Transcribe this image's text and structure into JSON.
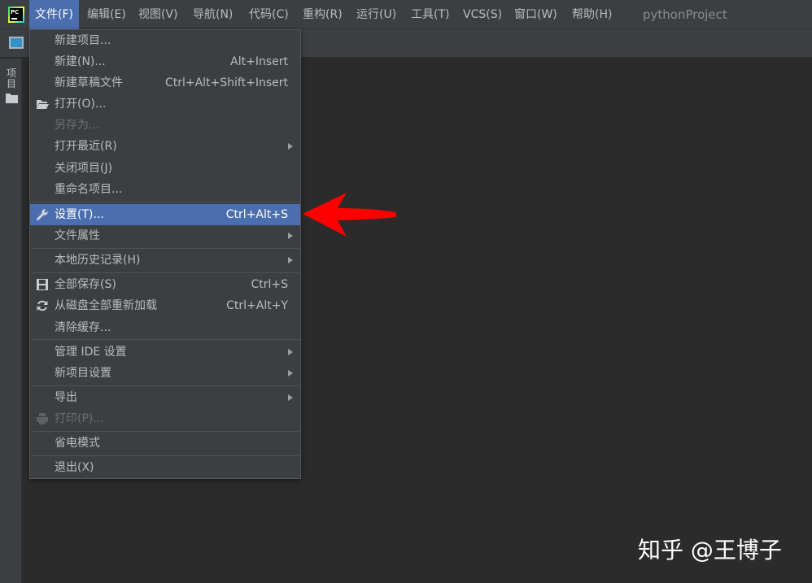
{
  "menubar": {
    "items": [
      {
        "label": "文件(F)"
      },
      {
        "label": "编辑(E)"
      },
      {
        "label": "视图(V)"
      },
      {
        "label": "导航(N)"
      },
      {
        "label": "代码(C)"
      },
      {
        "label": "重构(R)"
      },
      {
        "label": "运行(U)"
      },
      {
        "label": "工具(T)"
      },
      {
        "label": "VCS(S)"
      },
      {
        "label": "窗口(W)"
      },
      {
        "label": "帮助(H)"
      }
    ],
    "project_title": "pythonProject"
  },
  "app_logo": {
    "text": "PC",
    "icon": "pycharm-logo-icon"
  },
  "left_panel": {
    "project_tab_label": "项目"
  },
  "file_menu": {
    "items": [
      {
        "label": "新建项目...",
        "shortcut": ""
      },
      {
        "label": "新建(N)...",
        "shortcut": "Alt+Insert"
      },
      {
        "label": "新建草稿文件",
        "shortcut": "Ctrl+Alt+Shift+Insert"
      },
      {
        "label": "打开(O)...",
        "shortcut": "",
        "icon": "folder-open-icon"
      },
      {
        "label": "另存为...",
        "shortcut": "",
        "disabled": true
      },
      {
        "label": "打开最近(R)",
        "shortcut": "",
        "submenu": true
      },
      {
        "label": "关闭项目(J)",
        "shortcut": ""
      },
      {
        "label": "重命名项目...",
        "shortcut": ""
      },
      {
        "label": "设置(T)...",
        "shortcut": "Ctrl+Alt+S",
        "icon": "wrench-icon",
        "highlighted": true
      },
      {
        "label": "文件属性",
        "shortcut": "",
        "submenu": true
      },
      {
        "label": "本地历史记录(H)",
        "shortcut": "",
        "submenu": true
      },
      {
        "label": "全部保存(S)",
        "shortcut": "Ctrl+S",
        "icon": "save-icon"
      },
      {
        "label": "从磁盘全部重新加载",
        "shortcut": "Ctrl+Alt+Y",
        "icon": "reload-icon"
      },
      {
        "label": "清除缓存...",
        "shortcut": ""
      },
      {
        "label": "管理 IDE 设置",
        "shortcut": "",
        "submenu": true
      },
      {
        "label": "新项目设置",
        "shortcut": "",
        "submenu": true
      },
      {
        "label": "导出",
        "shortcut": "",
        "submenu": true
      },
      {
        "label": "打印(P)...",
        "shortcut": "",
        "icon": "print-icon",
        "disabled": true
      },
      {
        "label": "省电模式",
        "shortcut": ""
      },
      {
        "label": "退出(X)",
        "shortcut": ""
      }
    ]
  },
  "colors": {
    "menu_bg": "#3c3f41",
    "editor_bg": "#2b2b2b",
    "selection": "#4b6eaf",
    "annotation_arrow": "#ff0000"
  },
  "watermark": "知乎 @王博子"
}
